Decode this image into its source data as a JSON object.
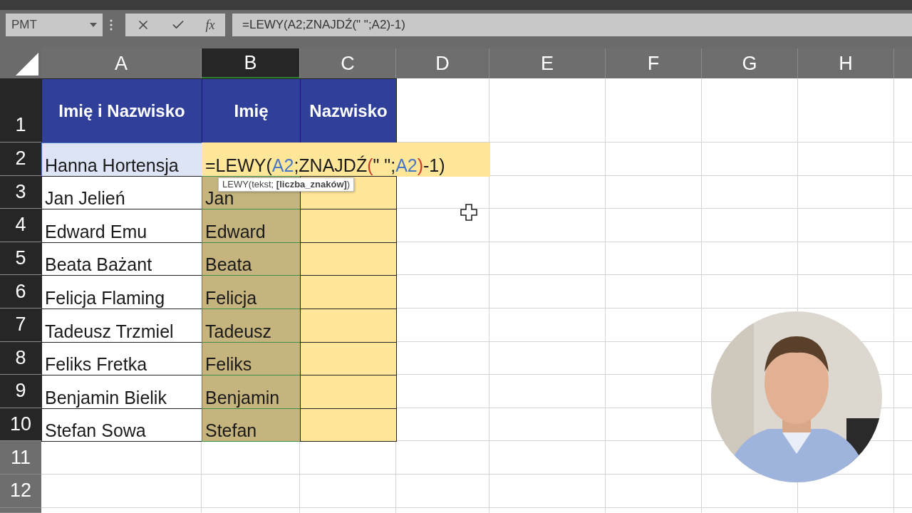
{
  "name_box": {
    "value": "PMT"
  },
  "formula_tools": {
    "function_label": "fx"
  },
  "formula_bar": {
    "value": "=LEWY(A2;ZNAJDŹ(\" \";A2)-1)"
  },
  "columns": [
    {
      "label": "A",
      "highlighted": false
    },
    {
      "label": "B",
      "highlighted": true
    },
    {
      "label": "C",
      "highlighted": false
    },
    {
      "label": "D",
      "highlighted": false
    },
    {
      "label": "E",
      "highlighted": false
    },
    {
      "label": "F",
      "highlighted": false
    },
    {
      "label": "G",
      "highlighted": false
    },
    {
      "label": "H",
      "highlighted": false
    }
  ],
  "rows": [
    {
      "label": "1",
      "highlighted": true,
      "kind": "header",
      "cells": [
        "Imię i Nazwisko",
        "Imię",
        "Nazwisko"
      ]
    },
    {
      "label": "2",
      "highlighted": true,
      "kind": "editing",
      "cells": [
        "Hanna Hortensja"
      ],
      "formula": [
        {
          "text": "=LEWY(",
          "color": "#1a1a1a"
        },
        {
          "text": "A2",
          "color": "#4a78c2"
        },
        {
          "text": ";ZNAJDŹ",
          "color": "#1a1a1a"
        },
        {
          "text": "(",
          "color": "#d03a2c"
        },
        {
          "text": "\" \";",
          "color": "#1a1a1a"
        },
        {
          "text": "A2",
          "color": "#4a78c2"
        },
        {
          "text": ")",
          "color": "#d03a2c"
        },
        {
          "text": "-1)",
          "color": "#1a1a1a"
        }
      ]
    },
    {
      "label": "3",
      "highlighted": true,
      "kind": "data",
      "cells": [
        "Jan Jelień",
        "Jan"
      ]
    },
    {
      "label": "4",
      "highlighted": true,
      "kind": "data",
      "cells": [
        "Edward Emu",
        "Edward"
      ]
    },
    {
      "label": "5",
      "highlighted": true,
      "kind": "data",
      "cells": [
        "Beata Bażant",
        "Beata"
      ]
    },
    {
      "label": "6",
      "highlighted": true,
      "kind": "data",
      "cells": [
        "Felicja Flaming",
        "Felicja"
      ]
    },
    {
      "label": "7",
      "highlighted": true,
      "kind": "data",
      "cells": [
        "Tadeusz Trzmiel",
        "Tadeusz"
      ]
    },
    {
      "label": "8",
      "highlighted": true,
      "kind": "data",
      "cells": [
        "Feliks Fretka",
        "Feliks"
      ]
    },
    {
      "label": "9",
      "highlighted": true,
      "kind": "data",
      "cells": [
        "Benjamin Bielik",
        "Benjamin"
      ]
    },
    {
      "label": "10",
      "highlighted": true,
      "kind": "data",
      "cells": [
        "Stefan Sowa",
        "Stefan"
      ]
    },
    {
      "label": "11",
      "highlighted": false,
      "kind": "empty",
      "cells": []
    },
    {
      "label": "12",
      "highlighted": false,
      "kind": "empty",
      "cells": []
    }
  ],
  "tooltip": {
    "text": "LEWY(tekst; **[liczba_znaków]**)"
  }
}
